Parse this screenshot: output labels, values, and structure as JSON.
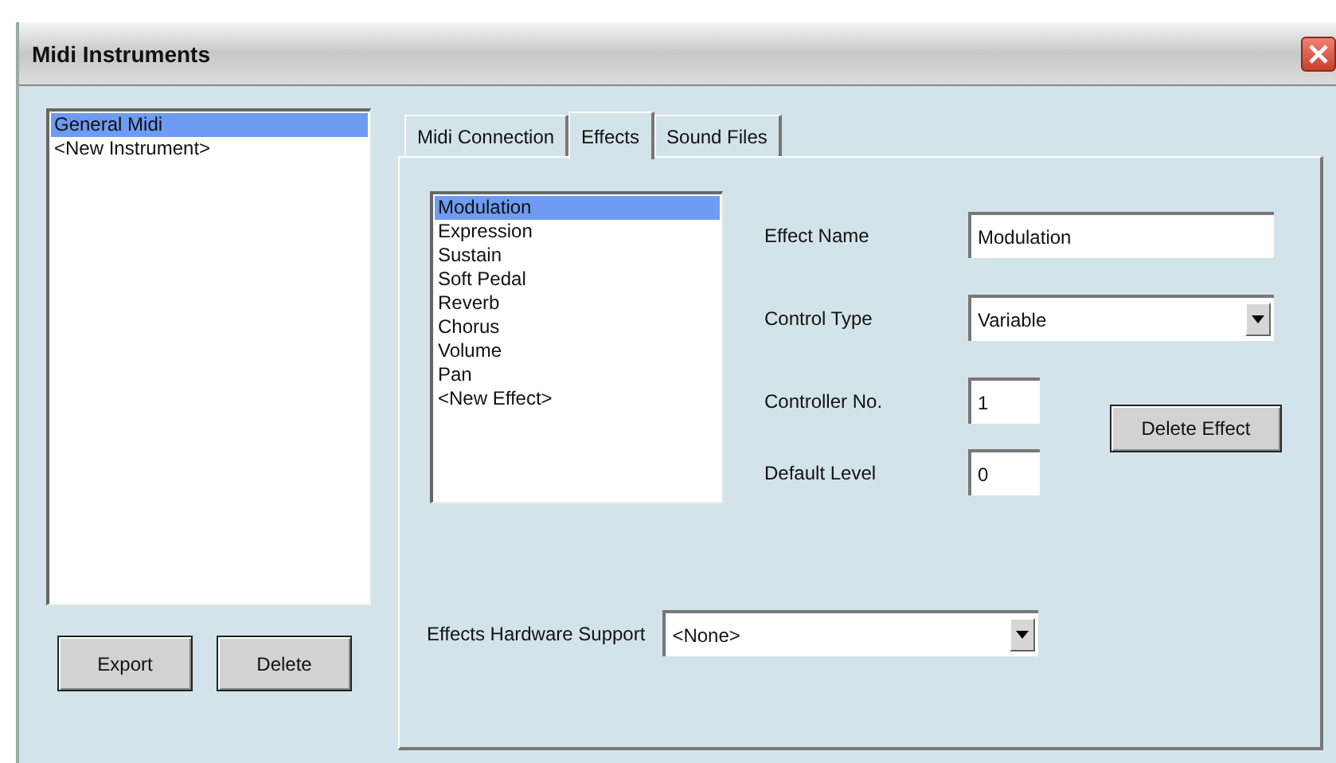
{
  "window": {
    "title": "Midi Instruments"
  },
  "instruments": [
    {
      "label": "General Midi",
      "selected": true
    },
    {
      "label": "<New Instrument>",
      "selected": false
    }
  ],
  "instrument_buttons": [
    "Export",
    "Delete"
  ],
  "tabs": [
    {
      "label": "Midi Connection",
      "selected": false
    },
    {
      "label": "Effects",
      "selected": true
    },
    {
      "label": "Sound Files",
      "selected": false
    }
  ],
  "effects": [
    {
      "label": "Modulation",
      "selected": true
    },
    {
      "label": "Expression",
      "selected": false
    },
    {
      "label": "Sustain",
      "selected": false
    },
    {
      "label": "Soft Pedal",
      "selected": false
    },
    {
      "label": "Reverb",
      "selected": false
    },
    {
      "label": "Chorus",
      "selected": false
    },
    {
      "label": "Volume",
      "selected": false
    },
    {
      "label": "Pan",
      "selected": false
    },
    {
      "label": "<New Effect>",
      "selected": false
    }
  ],
  "effect_name": {
    "label": "Effect Name",
    "value": "Modulation"
  },
  "control_type": {
    "label": "Control Type",
    "value": "Variable"
  },
  "controller_no": {
    "label": "Controller No.",
    "value": "1"
  },
  "default_level": {
    "label": "Default Level",
    "value": "0"
  },
  "delete_effect_button": "Delete Effect",
  "hardware_support": {
    "label": "Effects Hardware Support",
    "value": "<None>"
  }
}
